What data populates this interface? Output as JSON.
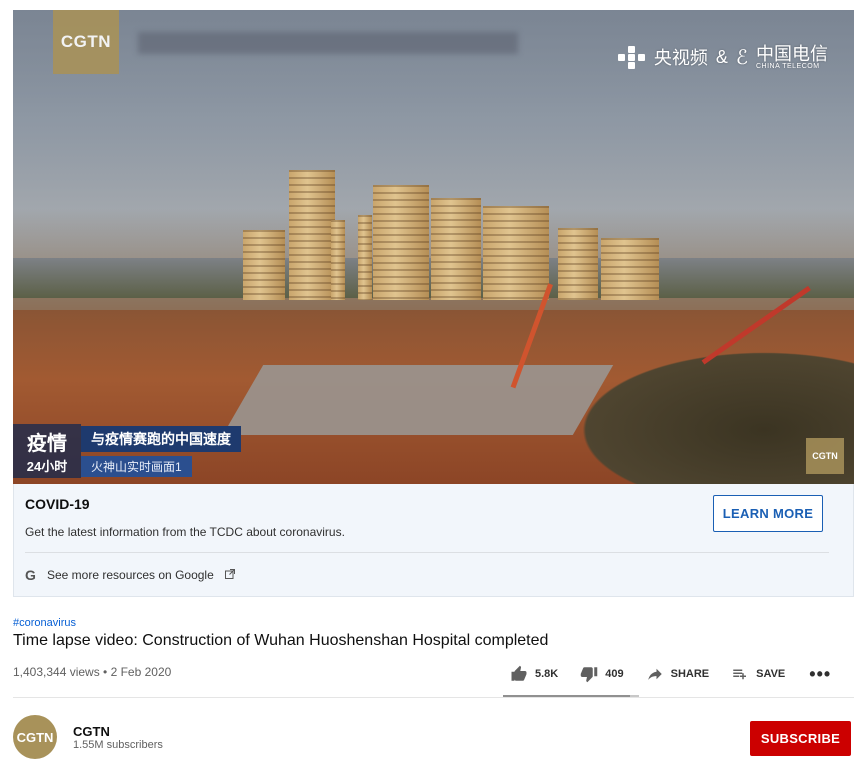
{
  "video": {
    "watermark": "CGTN",
    "broadcaster_cn": "央视频",
    "broadcaster_amp": "&",
    "telecom_cn": "中国电信",
    "telecom_en": "CHINA TELECOM",
    "lower_third_big": "疫情",
    "lower_third_small": "24小时",
    "lower_third_line1": "与疫情赛跑的中国速度",
    "lower_third_line2": "火神山实时画面1",
    "corner_logo": "CGTN"
  },
  "info_panel": {
    "title": "COVID-19",
    "description": "Get the latest information from the TCDC about coronavirus.",
    "button_label": "LEARN MORE",
    "resources_label": "See more resources on Google",
    "google_icon": "G"
  },
  "metadata": {
    "hashtag": "#coronavirus",
    "title": "Time lapse video: Construction of Wuhan Huoshenshan Hospital completed",
    "views_date": "1,403,344 views • 2 Feb 2020",
    "like_count": "5.8K",
    "dislike_count": "409",
    "share_label": "SHARE",
    "save_label": "SAVE",
    "more_label": "•••",
    "like_ratio": 0.934
  },
  "channel": {
    "avatar_text": "CGTN",
    "name": "CGTN",
    "subscribers": "1.55M subscribers",
    "subscribe_label": "SUBSCRIBE"
  },
  "colors": {
    "subscribe": "#cc0000",
    "link": "#065fd4",
    "panel_bg": "#f2f6fb",
    "cgtn_gold": "#a8925a"
  }
}
